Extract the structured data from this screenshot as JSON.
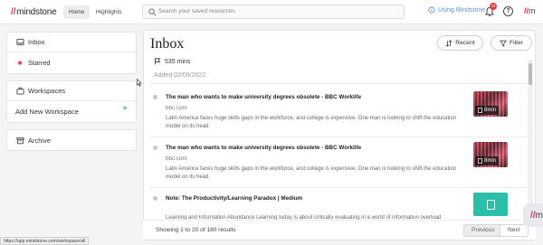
{
  "app": {
    "logo_slashes": "//",
    "logo_text": "mindstone",
    "tabs": [
      {
        "label": "Home"
      },
      {
        "label": "Highlights"
      }
    ],
    "search_placeholder": "Search your saved resources",
    "using_label": "Using Mindstone",
    "notification_count": "22",
    "help_label": "?",
    "mini_logo_slashes": "//",
    "mini_logo_text": "m"
  },
  "sidebar": {
    "inbox": "Inbox",
    "starred": "Starred",
    "workspaces": "Workspaces",
    "add_workspace": "Add New Workspace",
    "add_symbol": "+",
    "archive": "Archive"
  },
  "main": {
    "title": "Inbox",
    "recent_button": "Recent",
    "filter_button": "Filter",
    "total_time": "535 mins",
    "added_date": "Added 02/09/2022",
    "items": [
      {
        "title": "The man who wants to make university degrees obsolete - BBC Worklife",
        "source": "bbc.com",
        "description": "Latin America faces huge skills gaps in the workforce, and college is expensive. One man is looking to shift the education model on its head.",
        "duration": "8min"
      },
      {
        "title": "The man who wants to make university degrees obsolete - BBC Worklife",
        "source": "bbc.com",
        "description": "Latin America faces huge skills gaps in the workforce, and college is expensive. One man is looking to shift the education model on its head.",
        "duration": "8min"
      },
      {
        "title": "Note: The Productivity/Learning Paradox | Medium",
        "source": "",
        "description": "Learning and Information Abundance Learning today is about critically evaluating in a world of information overload",
        "duration": ""
      }
    ]
  },
  "footer": {
    "count_text": "Showing 1 to 20 of 180 results",
    "previous": "Previous",
    "next": "Next"
  },
  "status_url": "https://app.mindstone.com/workspace/all",
  "fab": {
    "slashes": "//",
    "text": "m"
  },
  "colors": {
    "brand": "#e0335a",
    "link": "#5a8fd0",
    "add": "#2a9a5a",
    "teal": "#29bfa8"
  }
}
